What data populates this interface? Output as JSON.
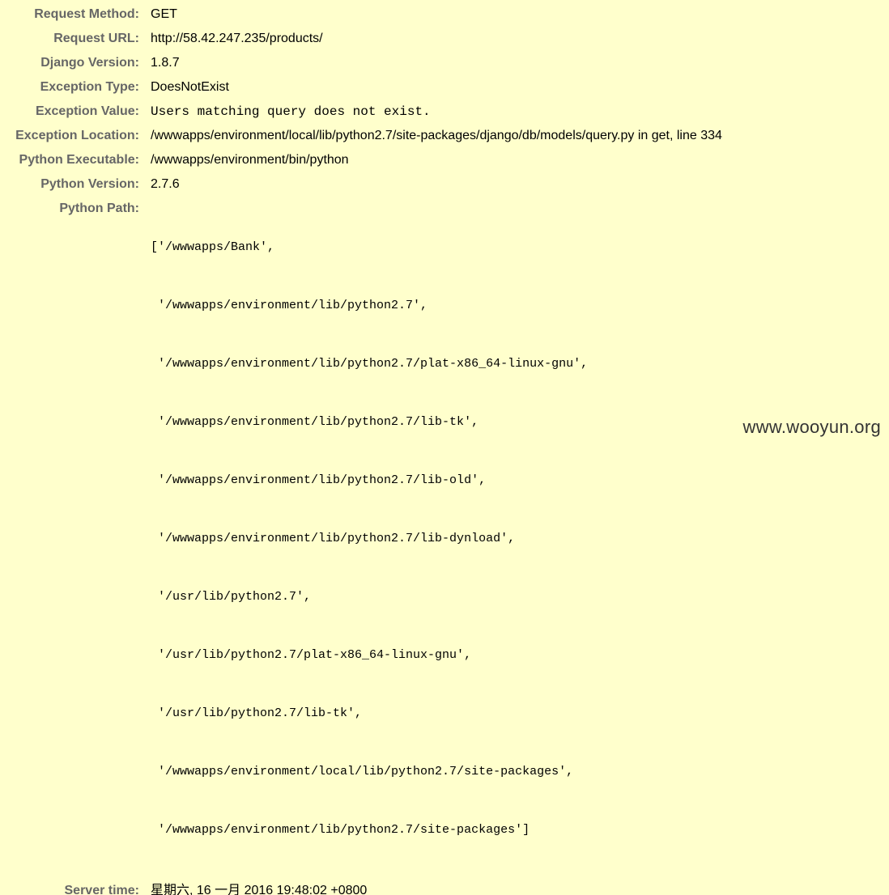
{
  "meta": {
    "request_method": {
      "label": "Request Method:",
      "value": "GET"
    },
    "request_url": {
      "label": "Request URL:",
      "value": "http://58.42.247.235/products/"
    },
    "django_version": {
      "label": "Django Version:",
      "value": "1.8.7"
    },
    "exception_type": {
      "label": "Exception Type:",
      "value": "DoesNotExist"
    },
    "exception_value": {
      "label": "Exception Value:",
      "value": "Users matching query does not exist."
    },
    "exception_location": {
      "label": "Exception Location:",
      "value": "/wwwapps/environment/local/lib/python2.7/site-packages/django/db/models/query.py in get, line 334"
    },
    "python_executable": {
      "label": "Python Executable:",
      "value": "/wwwapps/environment/bin/python"
    },
    "python_version": {
      "label": "Python Version:",
      "value": "2.7.6"
    },
    "python_path": {
      "label": "Python Path:",
      "lines": [
        "['/wwwapps/Bank',",
        " '/wwwapps/environment/lib/python2.7',",
        " '/wwwapps/environment/lib/python2.7/plat-x86_64-linux-gnu',",
        " '/wwwapps/environment/lib/python2.7/lib-tk',",
        " '/wwwapps/environment/lib/python2.7/lib-old',",
        " '/wwwapps/environment/lib/python2.7/lib-dynload',",
        " '/usr/lib/python2.7',",
        " '/usr/lib/python2.7/plat-x86_64-linux-gnu',",
        " '/usr/lib/python2.7/lib-tk',",
        " '/wwwapps/environment/local/lib/python2.7/site-packages',",
        " '/wwwapps/environment/lib/python2.7/site-packages']"
      ]
    },
    "server_time": {
      "label": "Server time:",
      "value": "星期六, 16 一月 2016 19:48:02 +0800"
    }
  },
  "watermark": "www.wooyun.org",
  "colors": {
    "background": "#ffffcc",
    "label": "#666666",
    "value": "#000000"
  }
}
